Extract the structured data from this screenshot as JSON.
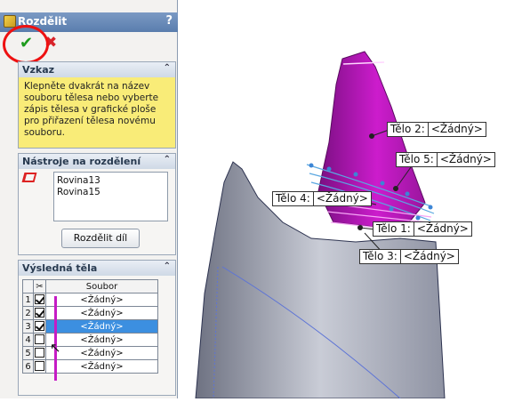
{
  "window": {
    "title": "Rozdělit",
    "help": "?"
  },
  "actions": {
    "ok_icon": "check-icon",
    "cancel_icon": "close-icon"
  },
  "message": {
    "heading": "Vzkaz",
    "text": "Klepněte dvakrát na název souboru tělesa nebo vyberte zápis tělesa v grafické ploše pro přiřazení tělesa novému souboru."
  },
  "tools": {
    "heading": "Nástroje na rozdělení",
    "items": [
      "Rovina13",
      "Rovina15"
    ],
    "split_button": "Rozdělit díl"
  },
  "results": {
    "heading": "Výsledná těla",
    "column_header": "Soubor",
    "rows": [
      {
        "num": "1",
        "checked": true,
        "name": "<Žádný>"
      },
      {
        "num": "2",
        "checked": true,
        "name": "<Žádný>"
      },
      {
        "num": "3",
        "checked": true,
        "name": "<Žádný>",
        "selected": true
      },
      {
        "num": "4",
        "checked": false,
        "name": "<Žádný>"
      },
      {
        "num": "5",
        "checked": false,
        "name": "<Žádný>"
      },
      {
        "num": "6",
        "checked": false,
        "name": "<Žádný>"
      }
    ]
  },
  "callouts": [
    {
      "label": "Tělo 2:",
      "value": "<Žádný>"
    },
    {
      "label": "Tělo 5:",
      "value": "<Žádný>"
    },
    {
      "label": "Tělo 4:",
      "value": "<Žádný>"
    },
    {
      "label": "Tělo 1:",
      "value": "<Žádný>"
    },
    {
      "label": "Tělo 3:",
      "value": "<Žádný>"
    }
  ],
  "colors": {
    "accent": "#c51bc5",
    "selection": "#3c8fe0",
    "message_bg": "#f9ec78"
  }
}
